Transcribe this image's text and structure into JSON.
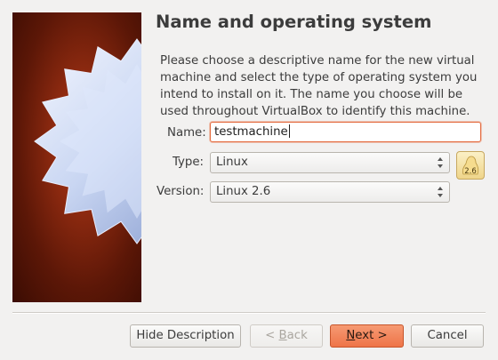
{
  "page": {
    "title": "Name and operating system",
    "description": "Please choose a descriptive name for the new virtual machine and select the type of operating system you intend to install on it. The name you choose will be used throughout VirtualBox to identify this machine."
  },
  "form": {
    "name_label": "Name:",
    "name_value": "testmachine",
    "type_label": "Type:",
    "type_value": "Linux",
    "version_label": "Version:",
    "version_value": "Linux 2.6",
    "os_badge_text": "2.6"
  },
  "buttons": {
    "hide_description": "Hide Description",
    "back_prefix": "< ",
    "back_mnemonic": "B",
    "back_rest": "ack",
    "next_mnemonic": "N",
    "next_rest": "ext >",
    "cancel": "Cancel"
  },
  "colors": {
    "primary_button": "#ee7448",
    "focus_border": "#e46b3f",
    "image_background": "#8e2a10",
    "window_background": "#f2f1f0"
  },
  "icons": {
    "wizard_watermark": "starburst",
    "os_badge": "linux-2.6-icon",
    "combo_arrows": "up-down-arrows-icon"
  }
}
